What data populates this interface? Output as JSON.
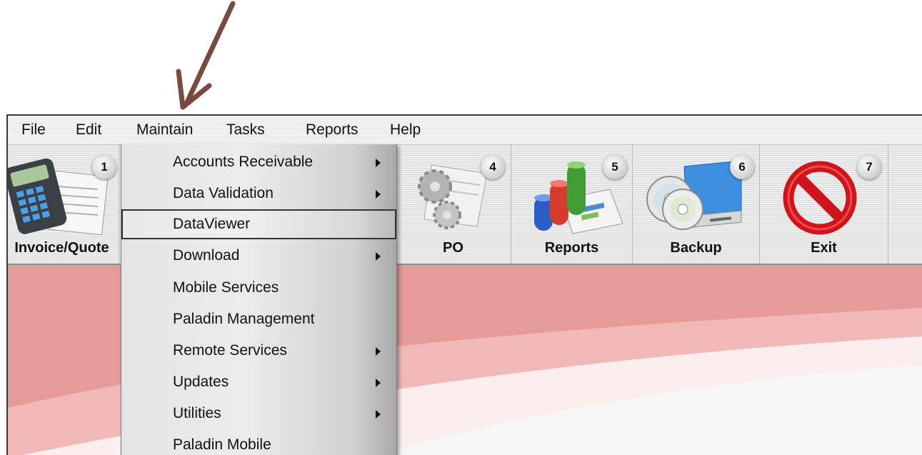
{
  "menubar": {
    "items": [
      {
        "label": "File"
      },
      {
        "label": "Edit"
      },
      {
        "label": "Maintain"
      },
      {
        "label": "Tasks"
      },
      {
        "label": "Reports"
      },
      {
        "label": "Help"
      }
    ]
  },
  "toolbar": {
    "buttons": [
      {
        "label": "Invoice/Quote",
        "badge": "1",
        "icon": "calculator-invoice-icon"
      },
      {
        "label": "PO",
        "badge": "4",
        "icon": "gears-document-icon"
      },
      {
        "label": "Reports",
        "badge": "5",
        "icon": "reports-chart-icon"
      },
      {
        "label": "Backup",
        "badge": "6",
        "icon": "backup-disc-drive-icon"
      },
      {
        "label": "Exit",
        "badge": "7",
        "icon": "exit-prohibited-icon"
      }
    ]
  },
  "maintain_menu": {
    "items": [
      {
        "label": "Accounts Receivable",
        "submenu": true
      },
      {
        "label": "Data Validation",
        "submenu": true
      },
      {
        "label": "DataViewer",
        "submenu": false,
        "selected": true
      },
      {
        "label": "Download",
        "submenu": true
      },
      {
        "label": "Mobile Services",
        "submenu": false
      },
      {
        "label": "Paladin Management",
        "submenu": false
      },
      {
        "label": "Remote Services",
        "submenu": true
      },
      {
        "label": "Updates",
        "submenu": true
      },
      {
        "label": "Utilities",
        "submenu": true
      },
      {
        "label": "Paladin Mobile",
        "submenu": false
      }
    ]
  },
  "colors": {
    "annotation_arrow": "#7a4a42",
    "background_pink": "#e69a9a",
    "exit_red": "#d0141c"
  }
}
